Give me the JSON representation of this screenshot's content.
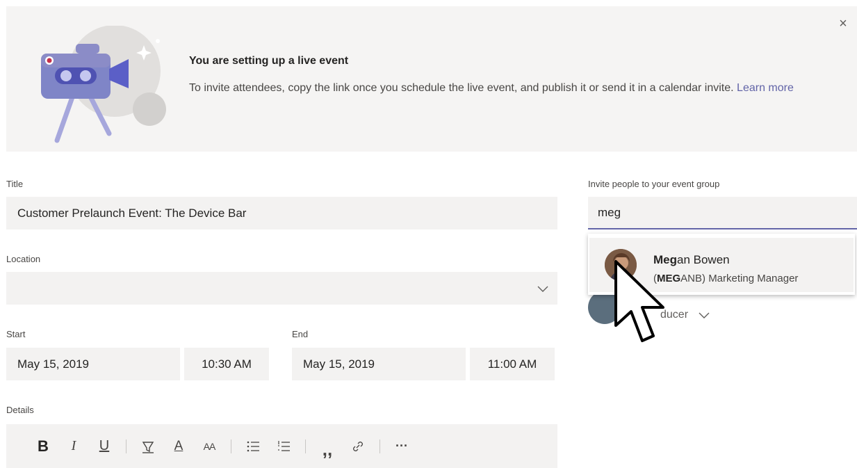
{
  "banner": {
    "title": "You are setting up a live event",
    "text": "To invite attendees, copy the link once you schedule the live event, and publish it or send it in a calendar invite.",
    "link_label": "Learn more",
    "close_label": "×"
  },
  "form": {
    "title_label": "Title",
    "title_value": "Customer Prelaunch Event: The Device Bar",
    "location_label": "Location",
    "location_value": "",
    "start_label": "Start",
    "start_date": "May 15, 2019",
    "start_time": "10:30 AM",
    "end_label": "End",
    "end_date": "May 15, 2019",
    "end_time": "11:00 AM",
    "details_label": "Details"
  },
  "toolbar": {
    "bold": "B",
    "italic": "I",
    "underline": "U",
    "highlight": "⯔",
    "font_color": "A",
    "font_size": "AA",
    "bullets": "☰",
    "numbered": "☰",
    "quote": "”",
    "link": "☍",
    "more": "···"
  },
  "invite": {
    "label": "Invite people to your event group",
    "query": "meg",
    "suggestion": {
      "name_match": "Meg",
      "name_rest": "an Bowen",
      "alias_match": "MEG",
      "alias_rest": "ANB",
      "title": "Marketing Manager"
    },
    "background_role": "ducer"
  },
  "colors": {
    "accent": "#6264a7",
    "banner_bg": "#f5f4f3",
    "field_bg": "#f3f2f1"
  }
}
